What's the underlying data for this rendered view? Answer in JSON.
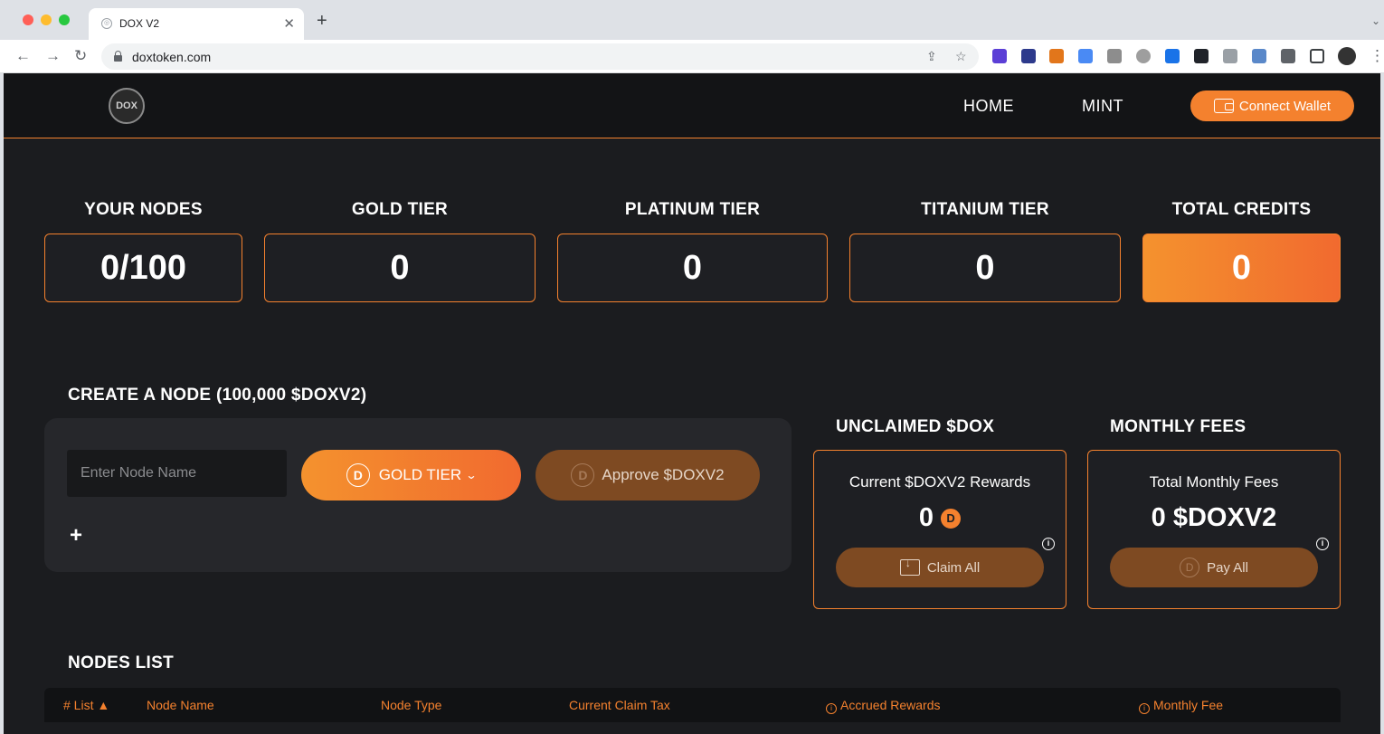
{
  "browser": {
    "tab_title": "DOX V2",
    "url": "doxtoken.com"
  },
  "header": {
    "logo_text": "DOX",
    "nav": [
      "HOME",
      "MINT"
    ],
    "connect_wallet": "Connect Wallet"
  },
  "stats": [
    {
      "label": "YOUR NODES",
      "value": "0/100"
    },
    {
      "label": "GOLD TIER",
      "value": "0"
    },
    {
      "label": "PLATINUM TIER",
      "value": "0"
    },
    {
      "label": "TITANIUM TIER",
      "value": "0"
    },
    {
      "label": "TOTAL CREDITS",
      "value": "0"
    }
  ],
  "create_node": {
    "title": "CREATE A NODE (100,000 $DOXV2)",
    "input_placeholder": "Enter Node Name",
    "tier_button": "GOLD TIER",
    "approve_button": "Approve $DOXV2",
    "coin_letter": "D",
    "add_symbol": "+"
  },
  "unclaimed": {
    "title": "UNCLAIMED $DOX",
    "subtitle": "Current $DOXV2 Rewards",
    "value": "0",
    "button": "Claim All"
  },
  "monthly_fees": {
    "title": "MONTHLY FEES",
    "subtitle": "Total Monthly Fees",
    "value": "0 $DOXV2",
    "button": "Pay All"
  },
  "nodes_list": {
    "title": "NODES LIST",
    "columns": [
      "# List ▲",
      "Node Name",
      "Node Type",
      "Current Claim Tax",
      "Accrued Rewards",
      "Monthly Fee"
    ]
  },
  "colors": {
    "accent": "#f4812e",
    "background": "#1b1c1f",
    "panel": "#26272b"
  }
}
